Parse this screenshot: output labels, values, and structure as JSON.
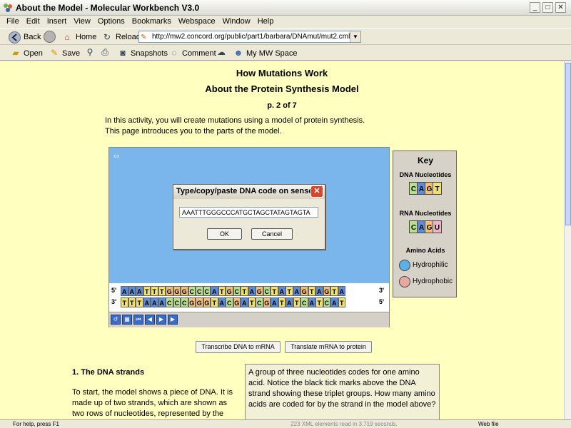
{
  "window": {
    "title": "About the Model - Molecular Workbench V3.0",
    "minimize": "_",
    "maximize": "□",
    "close": "✕"
  },
  "menu": [
    "File",
    "Edit",
    "Insert",
    "View",
    "Options",
    "Bookmarks",
    "Webspace",
    "Window",
    "Help"
  ],
  "nav": {
    "back": "Back",
    "home": "Home",
    "reload": "Reload",
    "url": "http://mw2.concord.org/public/part1/barbara/DNAmut/mut2.cml"
  },
  "toolbar": {
    "open": "Open",
    "save": "Save",
    "snapshots": "Snapshots",
    "comment": "Comment",
    "mymwspace": "My MW Space"
  },
  "page": {
    "title": "How Mutations Work",
    "subtitle": "About the Protein Synthesis Model",
    "pagenum": "p. 2 of 7",
    "intro_line1": "In this activity, you will create mutations using a model of protein synthesis.",
    "intro_line2": "This page introduces you to the parts of the model."
  },
  "model": {
    "strand_top": "AAATTTGGGCCCATGCTAGCTATAGTAGTA",
    "strand_bottom": "TTTAAACCCGGGTACGATCGATATCATCAT",
    "label_5": "5'",
    "label_3": "3'",
    "colors": {
      "A": "#5a8cd8",
      "T": "#f0e070",
      "G": "#f4c078",
      "C": "#b8e08c",
      "U": "#f4b0c8"
    }
  },
  "dialog": {
    "title": "Type/copy/paste DNA code on sense ...",
    "value": "AAATTTGGGCCCATGCTAGCTATAGTAGTA",
    "ok": "OK",
    "cancel": "Cancel"
  },
  "key": {
    "title": "Key",
    "dna_label": "DNA Nucleotides",
    "dna": [
      "C",
      "A",
      "G",
      "T"
    ],
    "rna_label": "RNA Nucleotides",
    "rna": [
      "C",
      "A",
      "G",
      "U"
    ],
    "aa_label": "Amino Acids",
    "hydrophilic": "Hydrophilic",
    "hydrophobic": "Hydrophobic"
  },
  "actions": {
    "transcribe": "Transcribe DNA to mRNA",
    "translate": "Translate mRNA to protein"
  },
  "section": {
    "heading": "1. The DNA strands",
    "para": "To start, the model shows a piece of DNA. It is made up of two strands, which are shown as two rows of nucleotides, represented by the"
  },
  "question": {
    "text": "A group of three nucleotides codes for one amino acid. Notice the black tick marks above the DNA strand showing these triplet groups. How many amino acids are coded for by the strand in the model above?"
  },
  "status": {
    "left": "For help, press F1",
    "center": "223 XML elements read in 3.719 seconds.",
    "right": "Web file"
  }
}
